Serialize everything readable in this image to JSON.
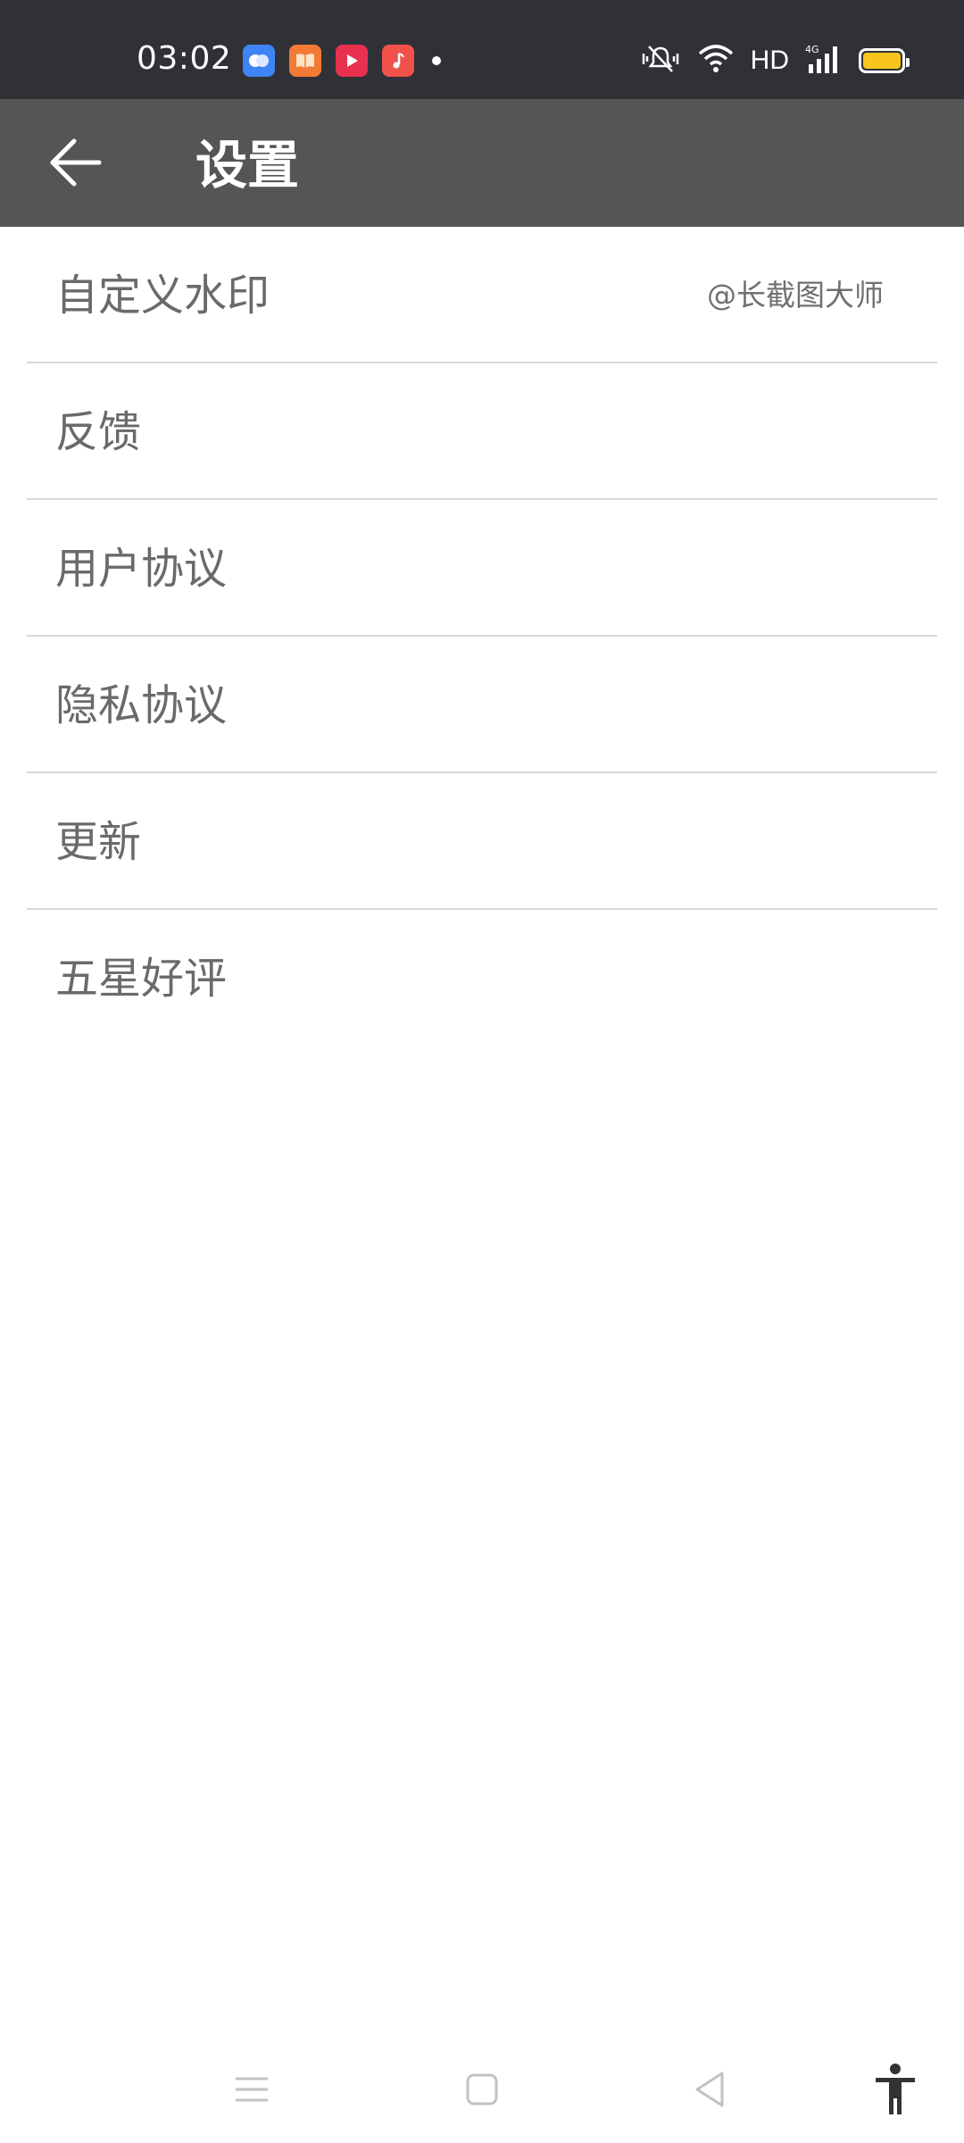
{
  "status_bar": {
    "time": "03:02",
    "network_label": "HD",
    "notification_icons": [
      "chat-app-icon",
      "book-app-icon",
      "video-app-icon",
      "music-app-icon"
    ],
    "colors": {
      "background": "#303136",
      "chat_app": "#3f84f3",
      "book_app": "#f27a34",
      "video_app": "#e8304f",
      "music_app": "#f0524a",
      "battery": "#f7c51b"
    }
  },
  "toolbar": {
    "title": "设置",
    "background": "#555555"
  },
  "settings": {
    "items": [
      {
        "label": "自定义水印",
        "value": "@长截图大师"
      },
      {
        "label": "反馈"
      },
      {
        "label": "用户协议"
      },
      {
        "label": "隐私协议"
      },
      {
        "label": "更新"
      },
      {
        "label": "五星好评"
      }
    ]
  }
}
